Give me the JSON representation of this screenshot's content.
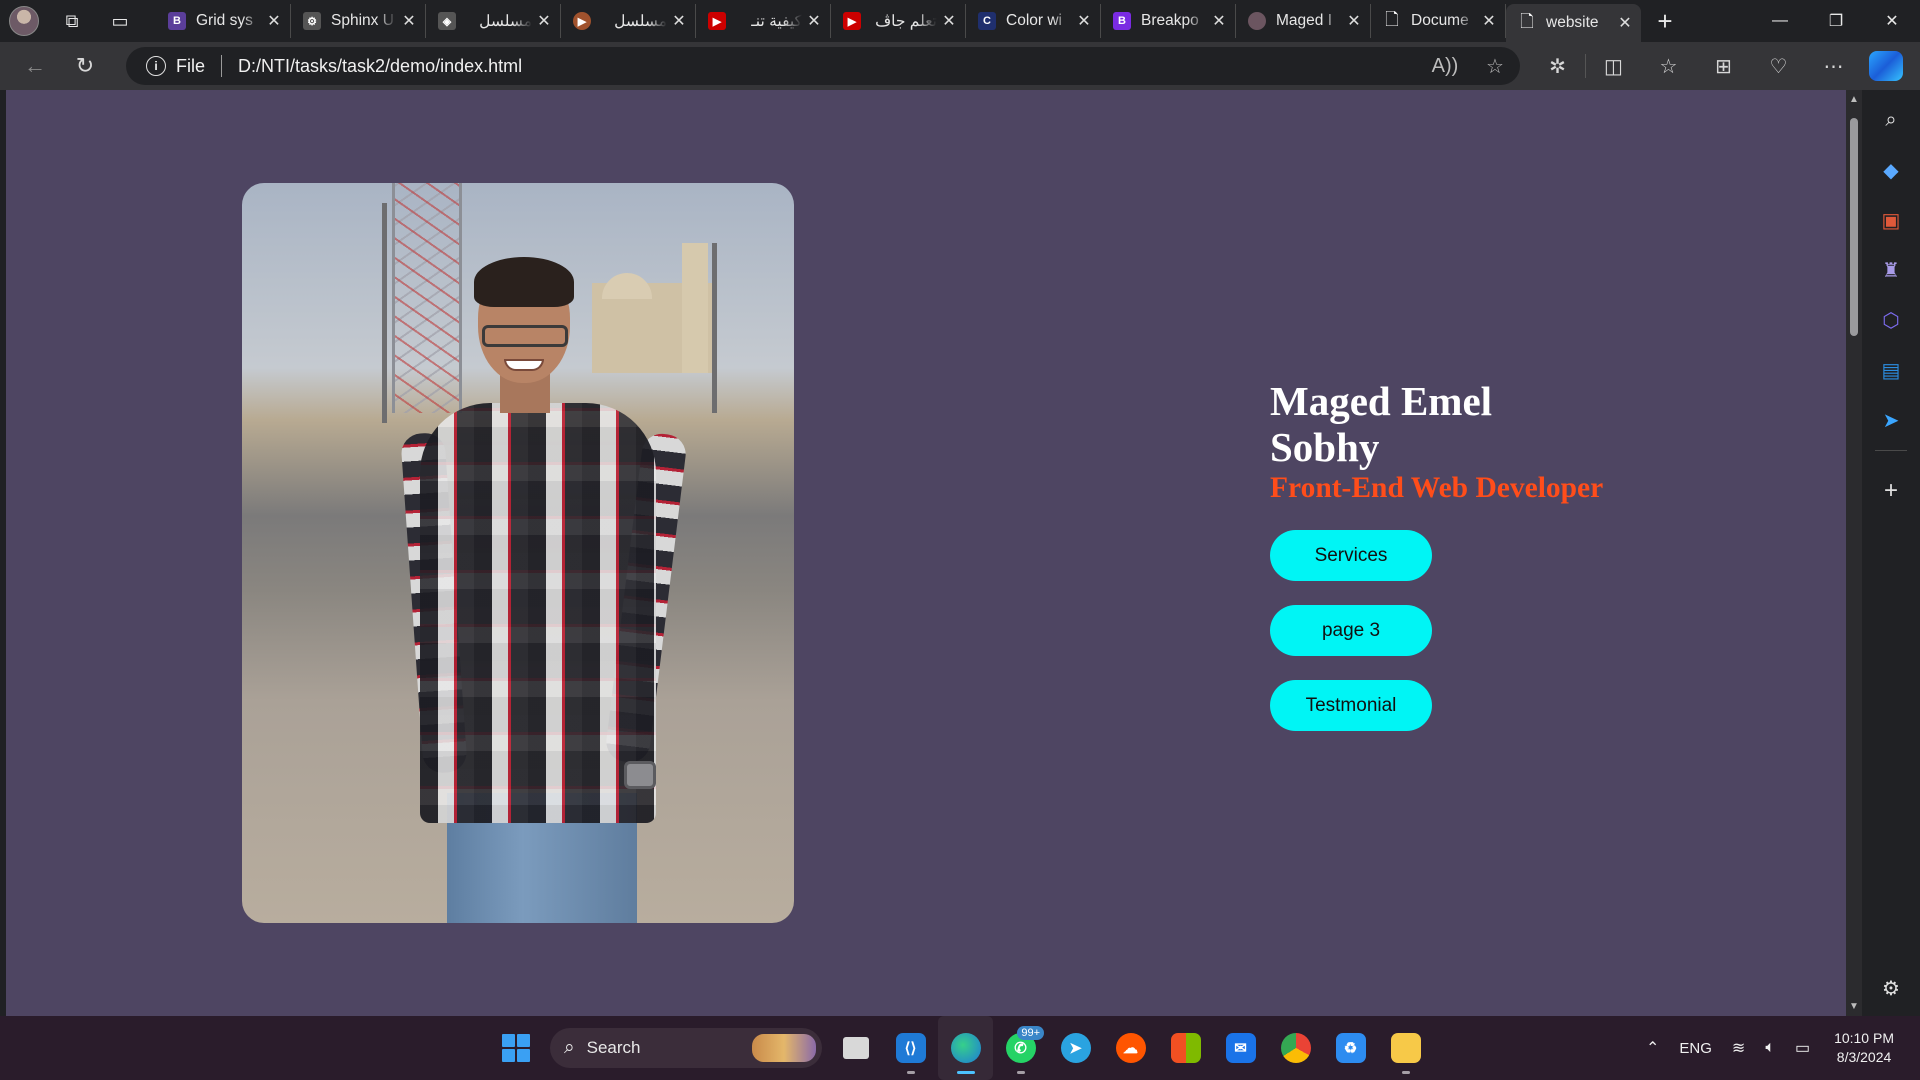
{
  "browser": {
    "tabs": [
      {
        "title": "Grid sys",
        "fav_color": "#5b3e9a",
        "fav_glyph": "B"
      },
      {
        "title": "Sphinx U",
        "fav_color": "#555555",
        "fav_glyph": "⚙"
      },
      {
        "title": "مسلسل",
        "fav_color": "#555555",
        "fav_glyph": "◈"
      },
      {
        "title": "مسلسل",
        "fav_color": "#a0522d",
        "fav_glyph": "▶"
      },
      {
        "title": "كيفية تنـ",
        "fav_color": "#cc0000",
        "fav_glyph": "▶"
      },
      {
        "title": "تعلم جاڤ",
        "fav_color": "#cc0000",
        "fav_glyph": "▶"
      },
      {
        "title": "Color wi",
        "fav_color": "#1f2f6e",
        "fav_glyph": "C"
      },
      {
        "title": "Breakpo",
        "fav_color": "#7a2be2",
        "fav_glyph": "B"
      },
      {
        "title": "Maged I",
        "fav_color": "#6b5560",
        "fav_glyph": "●"
      },
      {
        "title": "Docume",
        "fav_color": "transparent",
        "fav_glyph": "🗋"
      },
      {
        "title": "website",
        "fav_color": "transparent",
        "fav_glyph": "🗋",
        "active": true
      }
    ],
    "address": {
      "scheme_label": "File",
      "url": "D:/NTI/tasks/task2/demo/index.html"
    }
  },
  "page": {
    "name": "Maged Emel Sobhy",
    "role": "Front-End Web Developer",
    "buttons": {
      "services": "Services",
      "page3": "page 3",
      "testimonial": "Testmonial"
    },
    "colors": {
      "background": "#4e4562",
      "name": "#ffffff",
      "role": "#ff4d1a",
      "button": "#00f5f5"
    }
  },
  "taskbar": {
    "search_placeholder": "Search",
    "whatsapp_badge": "99+",
    "language": "ENG",
    "time": "10:10 PM",
    "date": "8/3/2024"
  }
}
